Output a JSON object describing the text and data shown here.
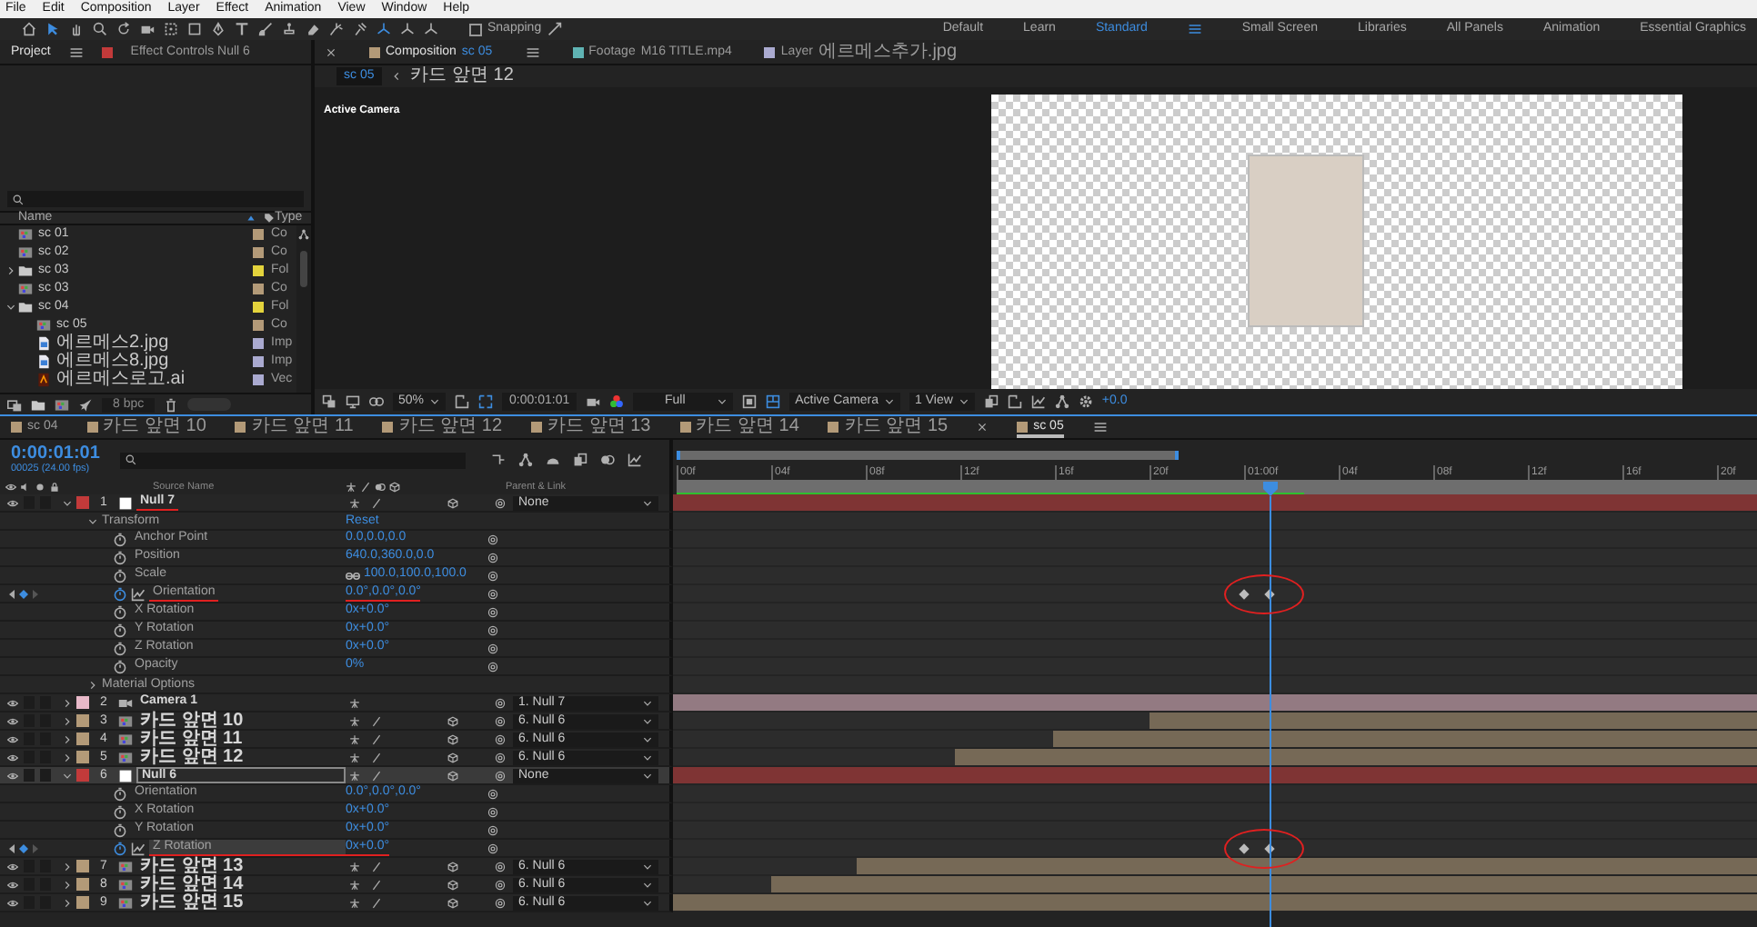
{
  "menu_bar": {
    "items": [
      "File",
      "Edit",
      "Composition",
      "Layer",
      "Effect",
      "Animation",
      "View",
      "Window",
      "Help"
    ]
  },
  "toolbar": {
    "tools": [
      {
        "kind": "home",
        "selected": false
      },
      {
        "kind": "selection",
        "selected": true
      },
      {
        "kind": "hand",
        "selected": false
      },
      {
        "kind": "zoom",
        "selected": false
      },
      {
        "kind": "rotate",
        "selected": false
      },
      {
        "kind": "camera",
        "selected": false
      },
      {
        "kind": "pan-behind",
        "selected": false
      },
      {
        "kind": "rectangle",
        "selected": false
      },
      {
        "kind": "pen",
        "selected": false
      },
      {
        "kind": "text",
        "selected": false
      },
      {
        "kind": "brush",
        "selected": false
      },
      {
        "kind": "stamp",
        "selected": false
      },
      {
        "kind": "eraser",
        "selected": false
      },
      {
        "kind": "roto",
        "selected": false
      },
      {
        "kind": "puppet",
        "selected": false
      },
      {
        "kind": "axis",
        "selected": true
      },
      {
        "kind": "axis",
        "selected": false
      },
      {
        "kind": "axis",
        "selected": false
      }
    ],
    "snapping": {
      "label": "Snapping",
      "checked": false
    },
    "workspaces": [
      {
        "label": "Default",
        "selected": false
      },
      {
        "label": "Learn",
        "selected": false
      },
      {
        "label": "Standard",
        "selected": true
      },
      {
        "label": "Small Screen",
        "selected": false
      },
      {
        "label": "Libraries",
        "selected": false
      },
      {
        "label": "All Panels",
        "selected": false
      },
      {
        "label": "Animation",
        "selected": false
      },
      {
        "label": "Essential Graphics",
        "selected": false
      }
    ]
  },
  "project_panel": {
    "tabs": [
      {
        "label": "Project",
        "selected": true
      },
      {
        "label": "Effect Controls Null 6",
        "selected": false
      }
    ],
    "columns": {
      "name": "Name",
      "type": "Type"
    },
    "items": [
      {
        "name": "sc 01",
        "type": "Co",
        "kind": "comp",
        "color": "#b39a78"
      },
      {
        "name": "sc 02",
        "type": "Co",
        "kind": "comp",
        "color": "#b39a78"
      },
      {
        "name": "sc 03",
        "type": "Fol",
        "kind": "folder",
        "color": "#e3d33c",
        "expanded": false
      },
      {
        "name": "sc 03",
        "type": "Co",
        "kind": "comp",
        "color": "#b39a78"
      },
      {
        "name": "sc 04",
        "type": "Fol",
        "kind": "folder",
        "color": "#e3d33c",
        "expanded": true,
        "children": [
          {
            "name": "sc 05",
            "type": "Co",
            "kind": "comp",
            "color": "#b39a78"
          },
          {
            "name": "에르메스2.jpg",
            "type": "Imp",
            "kind": "image",
            "color": "#aaaad0"
          },
          {
            "name": "에르메스8.jpg",
            "type": "Imp",
            "kind": "image",
            "color": "#aaaad0"
          },
          {
            "name": "에르메스로고.ai",
            "type": "Vec",
            "kind": "vector",
            "color": "#aaaad0"
          }
        ]
      }
    ],
    "bit_depth": "8 bpc"
  },
  "viewer": {
    "tabs": [
      {
        "type_label": "Composition",
        "name": "sc 05",
        "color": "#b39a78",
        "selected": true
      },
      {
        "type_label": "Footage",
        "name": "M16 TITLE.mp4",
        "color": "#5fb3b3",
        "selected": false
      },
      {
        "type_label": "Layer",
        "name": "에르메스추가.jpg",
        "color": "#aaaad0",
        "selected": false
      }
    ],
    "breadcrumbs": [
      "sc 05",
      "카드 앞면 12"
    ],
    "camera_label": "Active Camera",
    "controls": {
      "zoom": "50%",
      "timecode": "0:00:01:01",
      "resolution": "Full",
      "camera": "Active Camera",
      "views": "1 View",
      "exposure": "+0.0"
    }
  },
  "timeline": {
    "tabs": [
      {
        "label": "sc 04",
        "selected": false
      },
      {
        "label": "카드 앞면 10",
        "selected": false
      },
      {
        "label": "카드 앞면 11",
        "selected": false
      },
      {
        "label": "카드 앞면 12",
        "selected": false
      },
      {
        "label": "카드 앞면 13",
        "selected": false
      },
      {
        "label": "카드 앞면 14",
        "selected": false
      },
      {
        "label": "카드 앞면 15",
        "selected": false
      },
      {
        "label": "sc 05",
        "selected": true
      }
    ],
    "timecode": "0:00:01:01",
    "frame_info": "00025 (24.00 fps)",
    "columns": {
      "source_name": "Source Name",
      "parent": "Parent & Link"
    },
    "ruler": [
      "00f",
      "04f",
      "08f",
      "12f",
      "16f",
      "20f",
      "01:00f",
      "04f",
      "08f",
      "12f",
      "16f",
      "20f"
    ],
    "layers": [
      {
        "number": "1",
        "name": "Null 7",
        "kind": "null",
        "color": "#c23a3a",
        "expanded": true,
        "selected": false,
        "annotated": true,
        "parent": "None",
        "level": 1,
        "children": [
          {
            "kind": "group",
            "name": "Transform",
            "value": "Reset",
            "expanded": true,
            "children": [
              {
                "kind": "property",
                "name": "Anchor Point",
                "value": "0.0,0.0,0.0",
                "animated": false,
                "selected": false,
                "annotated": false
              },
              {
                "kind": "property",
                "name": "Position",
                "value": "640.0,360.0,0.0",
                "animated": false,
                "selected": false,
                "annotated": false
              },
              {
                "kind": "property",
                "name": "Scale",
                "value": "100.0,100.0,100.0",
                "linked": true,
                "animated": false,
                "selected": false,
                "annotated": false
              },
              {
                "kind": "property",
                "name": "Orientation",
                "value": "0.0°,0.0°,0.0°",
                "animated": true,
                "selected": false,
                "annotated": true
              },
              {
                "kind": "property",
                "name": "X Rotation",
                "value": "0x+0.0°",
                "animated": false,
                "selected": false,
                "annotated": false
              },
              {
                "kind": "property",
                "name": "Y Rotation",
                "value": "0x+0.0°",
                "animated": false,
                "selected": false,
                "annotated": false
              },
              {
                "kind": "property",
                "name": "Z Rotation",
                "value": "0x+0.0°",
                "animated": false,
                "selected": false,
                "annotated": false
              },
              {
                "kind": "property",
                "name": "Opacity",
                "value": "0%",
                "animated": false,
                "selected": false,
                "annotated": false
              }
            ]
          },
          {
            "kind": "group",
            "name": "Material Options",
            "expanded": false
          }
        ]
      },
      {
        "number": "2",
        "name": "Camera 1",
        "kind": "camera",
        "color": "#e8b9c9",
        "expanded": false,
        "selected": false,
        "annotated": false,
        "parent": "1. Null 7",
        "level": 1
      },
      {
        "number": "3",
        "name": "카드 앞면 10",
        "kind": "comp",
        "color": "#b39a78",
        "expanded": false,
        "selected": false,
        "annotated": false,
        "parent": "6. Null 6",
        "level": 0.56
      },
      {
        "number": "4",
        "name": "카드 앞면 11",
        "kind": "comp",
        "color": "#b39a78",
        "expanded": false,
        "selected": false,
        "annotated": false,
        "parent": "6. Null 6",
        "level": 0.65
      },
      {
        "number": "5",
        "name": "카드 앞면 12",
        "kind": "comp",
        "color": "#b39a78",
        "expanded": false,
        "selected": false,
        "annotated": false,
        "parent": "6. Null 6",
        "level": 0.74
      },
      {
        "number": "6",
        "name": "Null 6",
        "kind": "null",
        "color": "#c23a3a",
        "expanded": true,
        "selected": true,
        "annotated": true,
        "parent": "None",
        "level": 1,
        "children": [
          {
            "kind": "property",
            "name": "Orientation",
            "value": "0.0°,0.0°,0.0°",
            "animated": false,
            "selected": false,
            "annotated": false
          },
          {
            "kind": "property",
            "name": "X Rotation",
            "value": "0x+0.0°",
            "animated": false,
            "selected": false,
            "annotated": false
          },
          {
            "kind": "property",
            "name": "Y Rotation",
            "value": "0x+0.0°",
            "animated": false,
            "selected": false,
            "annotated": false
          },
          {
            "kind": "property",
            "name": "Z Rotation",
            "value": "0x+0.0°",
            "animated": true,
            "selected": true,
            "annotated": true
          }
        ]
      },
      {
        "number": "7",
        "name": "카드 앞면 13",
        "kind": "comp",
        "color": "#b39a78",
        "expanded": false,
        "selected": false,
        "annotated": false,
        "parent": "6. Null 6",
        "level": 0.83
      },
      {
        "number": "8",
        "name": "카드 앞면 14",
        "kind": "comp",
        "color": "#b39a78",
        "expanded": false,
        "selected": false,
        "annotated": false,
        "parent": "6. Null 6",
        "level": 0.91
      },
      {
        "number": "9",
        "name": "카드 앞면 15",
        "kind": "comp",
        "color": "#b39a78",
        "expanded": false,
        "selected": false,
        "annotated": false,
        "parent": "6. Null 6",
        "level": 1
      }
    ]
  }
}
